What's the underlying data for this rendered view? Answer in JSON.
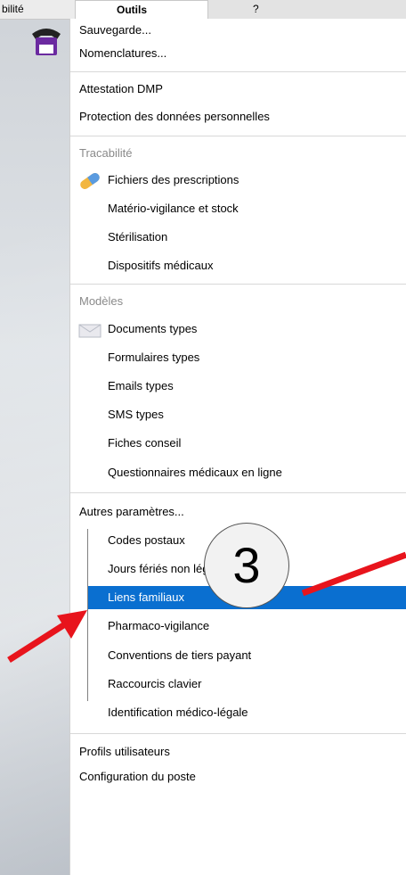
{
  "menubar": {
    "left_item": "bilité",
    "outils": "Outils",
    "help": "?"
  },
  "menu": {
    "items": [
      {
        "label": "Sauvegarde...",
        "top": 0
      },
      {
        "label": "Nomenclatures..."
      },
      {
        "label": "Attestation DMP"
      },
      {
        "label": "Protection des données personnelles"
      },
      {
        "label": "Tracabilité"
      },
      {
        "label": "Fichiers des prescriptions"
      },
      {
        "label": "Matério-vigilance et stock"
      },
      {
        "label": "Stérilisation"
      },
      {
        "label": "Dispositifs médicaux"
      },
      {
        "label": "Modèles"
      },
      {
        "label": "Documents types"
      },
      {
        "label": "Formulaires types"
      },
      {
        "label": "Emails types"
      },
      {
        "label": "SMS types"
      },
      {
        "label": "Fiches conseil"
      },
      {
        "label": "Questionnaires médicaux en ligne"
      },
      {
        "label": "Autres paramètres..."
      },
      {
        "label": "Codes postaux"
      },
      {
        "label": "Jours fériés non légaux"
      },
      {
        "label": "Liens familiaux"
      },
      {
        "label": "Pharmaco-vigilance"
      },
      {
        "label": "Conventions de tiers payant"
      },
      {
        "label": "Raccourcis clavier"
      },
      {
        "label": "Identification médico-légale"
      },
      {
        "label": "Profils utilisateurs"
      },
      {
        "label": "Configuration du poste"
      }
    ]
  },
  "annotation": {
    "step": "3"
  },
  "colors": {
    "selection": "#0a6fd0",
    "arrow": "#e8141c"
  }
}
